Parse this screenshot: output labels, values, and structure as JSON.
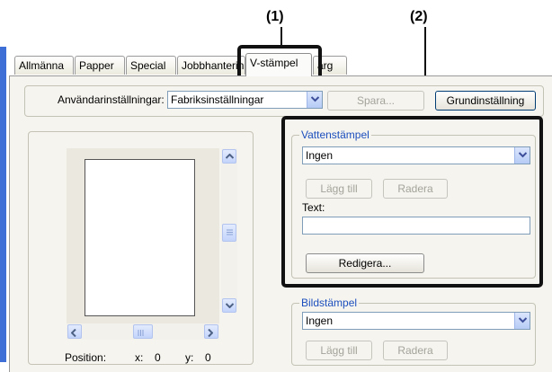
{
  "callouts": [
    "(1)",
    "(2)"
  ],
  "tabs": [
    "Allmänna",
    "Papper",
    "Special",
    "Jobbhanterin",
    "V-stämpel",
    "ärg"
  ],
  "user_settings": {
    "label": "Användarinställningar:",
    "value": "Fabriksinställningar",
    "save": "Spara...",
    "default": "Grundinställning"
  },
  "watermark": {
    "group_label": "Vattenstämpel",
    "selected": "Ingen",
    "add": "Lägg till",
    "delete": "Radera",
    "text_label": "Text:",
    "text_value": "",
    "edit": "Redigera..."
  },
  "image_stamp": {
    "group_label": "Bildstämpel",
    "selected": "Ingen",
    "add": "Lägg till",
    "delete": "Radera"
  },
  "position": {
    "label": "Position:",
    "x_label": "x:",
    "x_value": "0",
    "y_label": "y:",
    "y_value": "0"
  },
  "icons": {
    "scroll_up": "arrow-up-icon",
    "scroll_down": "arrow-down-icon",
    "scroll_left": "arrow-left-icon",
    "scroll_right": "arrow-right-icon",
    "dropdown": "chevron-down-icon"
  }
}
